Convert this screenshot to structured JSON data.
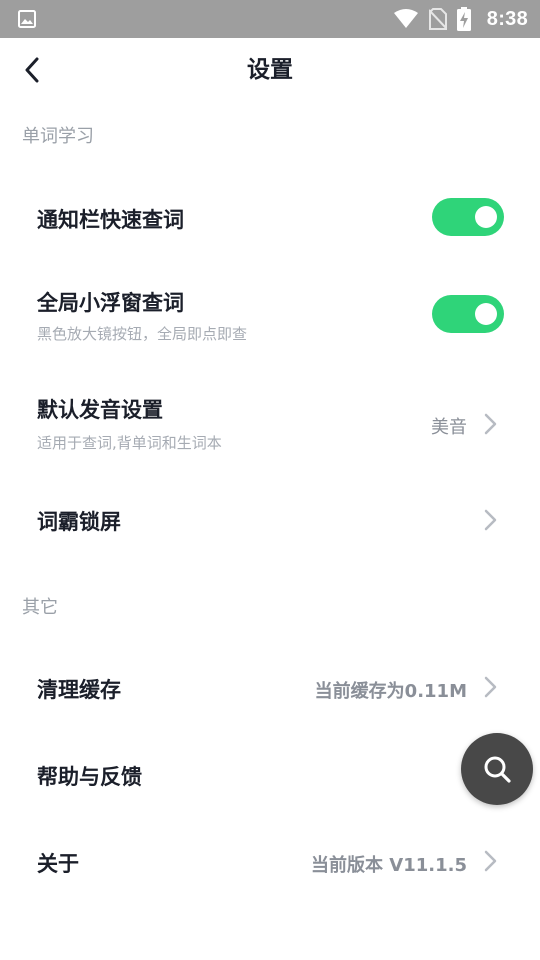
{
  "status_bar": {
    "time": "8:38"
  },
  "header": {
    "title": "设置"
  },
  "sections": {
    "word_learning": {
      "title": "单词学习",
      "notification_lookup": {
        "label": "通知栏快速查词",
        "enabled": true
      },
      "floating_window_lookup": {
        "label": "全局小浮窗查词",
        "subtitle": "黑色放大镜按钮，全局即点即查",
        "enabled": true
      },
      "default_pronunciation": {
        "label": "默认发音设置",
        "subtitle": "适用于查词,背单词和生词本",
        "value": "美音"
      },
      "lock_screen": {
        "label": "词霸锁屏"
      }
    },
    "other": {
      "title": "其它",
      "clear_cache": {
        "label": "清理缓存",
        "value": "当前缓存为0.11M"
      },
      "help_feedback": {
        "label": "帮助与反馈"
      },
      "about": {
        "label": "关于",
        "value": "当前版本 V11.1.5"
      }
    }
  },
  "colors": {
    "toggle_on": "#2fd479",
    "status_bar": "#9e9e9e",
    "fab": "#484848"
  },
  "icons": [
    "gallery-icon",
    "wifi-icon",
    "no-sim-icon",
    "battery-charging-icon",
    "back-arrow-icon",
    "chevron-right-icon",
    "search-icon"
  ]
}
